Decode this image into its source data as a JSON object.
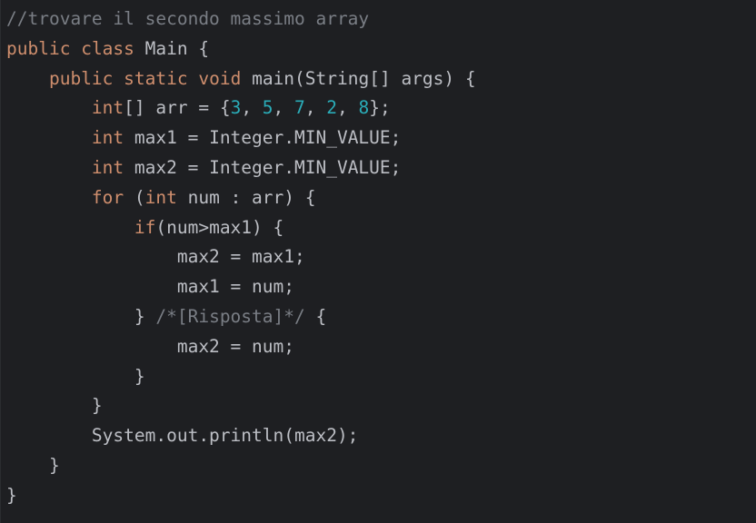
{
  "editor": {
    "colors": {
      "background": "#1e1f22",
      "text": "#bcbec4",
      "keyword": "#cf8e6d",
      "number": "#2aacb8",
      "comment": "#7a7e85"
    },
    "lines": [
      {
        "tokens": [
          {
            "type": "comment",
            "text": "//trovare il secondo massimo array"
          }
        ]
      },
      {
        "tokens": [
          {
            "type": "kw",
            "text": "public"
          },
          {
            "type": "plain",
            "text": " "
          },
          {
            "type": "kw",
            "text": "class"
          },
          {
            "type": "plain",
            "text": " Main {"
          }
        ]
      },
      {
        "tokens": [
          {
            "type": "plain",
            "text": "    "
          },
          {
            "type": "kw",
            "text": "public"
          },
          {
            "type": "plain",
            "text": " "
          },
          {
            "type": "kw",
            "text": "static"
          },
          {
            "type": "plain",
            "text": " "
          },
          {
            "type": "kw",
            "text": "void"
          },
          {
            "type": "plain",
            "text": " main(String[] args) {"
          }
        ]
      },
      {
        "tokens": [
          {
            "type": "plain",
            "text": "        "
          },
          {
            "type": "kw",
            "text": "int"
          },
          {
            "type": "plain",
            "text": "[] arr = {"
          },
          {
            "type": "num",
            "text": "3"
          },
          {
            "type": "plain",
            "text": ", "
          },
          {
            "type": "num",
            "text": "5"
          },
          {
            "type": "plain",
            "text": ", "
          },
          {
            "type": "num",
            "text": "7"
          },
          {
            "type": "plain",
            "text": ", "
          },
          {
            "type": "num",
            "text": "2"
          },
          {
            "type": "plain",
            "text": ", "
          },
          {
            "type": "num",
            "text": "8"
          },
          {
            "type": "plain",
            "text": "};"
          }
        ]
      },
      {
        "tokens": [
          {
            "type": "plain",
            "text": "        "
          },
          {
            "type": "kw",
            "text": "int"
          },
          {
            "type": "plain",
            "text": " max1 = Integer.MIN_VALUE;"
          }
        ]
      },
      {
        "tokens": [
          {
            "type": "plain",
            "text": "        "
          },
          {
            "type": "kw",
            "text": "int"
          },
          {
            "type": "plain",
            "text": " max2 = Integer.MIN_VALUE;"
          }
        ]
      },
      {
        "tokens": [
          {
            "type": "plain",
            "text": "        "
          },
          {
            "type": "kw",
            "text": "for"
          },
          {
            "type": "plain",
            "text": " ("
          },
          {
            "type": "kw",
            "text": "int"
          },
          {
            "type": "plain",
            "text": " num : arr) {"
          }
        ]
      },
      {
        "tokens": [
          {
            "type": "plain",
            "text": "            "
          },
          {
            "type": "kw",
            "text": "if"
          },
          {
            "type": "plain",
            "text": "(num>max1) {"
          }
        ]
      },
      {
        "tokens": [
          {
            "type": "plain",
            "text": "                max2 = max1;"
          }
        ]
      },
      {
        "tokens": [
          {
            "type": "plain",
            "text": "                max1 = num;"
          }
        ]
      },
      {
        "tokens": [
          {
            "type": "plain",
            "text": "            } "
          },
          {
            "type": "comment",
            "text": "/*[Risposta]*/"
          },
          {
            "type": "plain",
            "text": " {"
          }
        ]
      },
      {
        "tokens": [
          {
            "type": "plain",
            "text": "                max2 = num;"
          }
        ]
      },
      {
        "tokens": [
          {
            "type": "plain",
            "text": "            }"
          }
        ]
      },
      {
        "tokens": [
          {
            "type": "plain",
            "text": "        }"
          }
        ]
      },
      {
        "tokens": [
          {
            "type": "plain",
            "text": "        System.out.println(max2);"
          }
        ]
      },
      {
        "tokens": [
          {
            "type": "plain",
            "text": "    }"
          }
        ]
      },
      {
        "tokens": [
          {
            "type": "plain",
            "text": "}"
          }
        ]
      }
    ]
  }
}
